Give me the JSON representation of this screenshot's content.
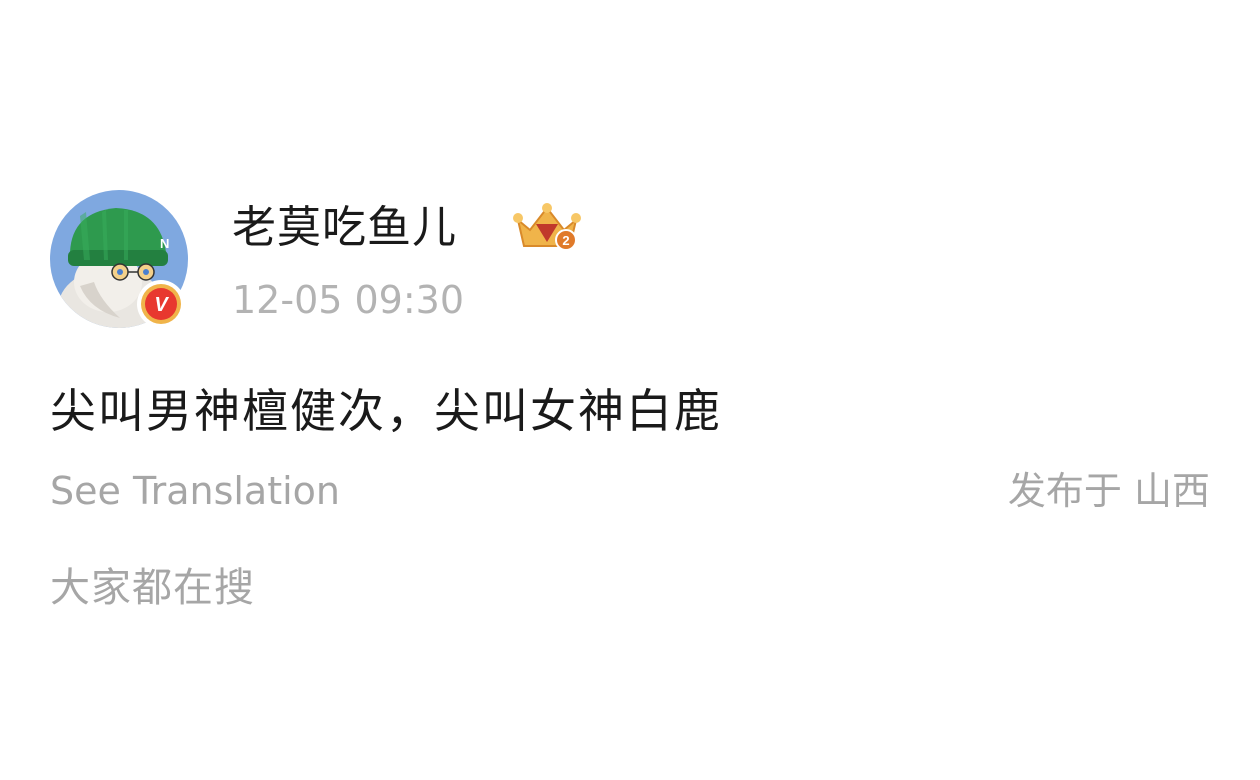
{
  "post": {
    "author": {
      "name": "老莫吃鱼儿",
      "avatar_icon": "cat-avatar-green-hat",
      "verified_icon": "verified-v-badge",
      "verified_letter": "V",
      "rank_badge_icon": "crown-rank-badge",
      "rank_badge_number": "2"
    },
    "timestamp": "12-05 09:30",
    "text": "尖叫男神檀健次，尖叫女神白鹿",
    "translate_label": "See Translation",
    "location_label": "发布于 山西"
  },
  "trending": {
    "label": "大家都在搜"
  },
  "colors": {
    "primary_text": "#1a1a1a",
    "secondary_text": "#a6a6a6",
    "verified_red": "#e8382f",
    "badge_gold": "#f0b44a"
  }
}
